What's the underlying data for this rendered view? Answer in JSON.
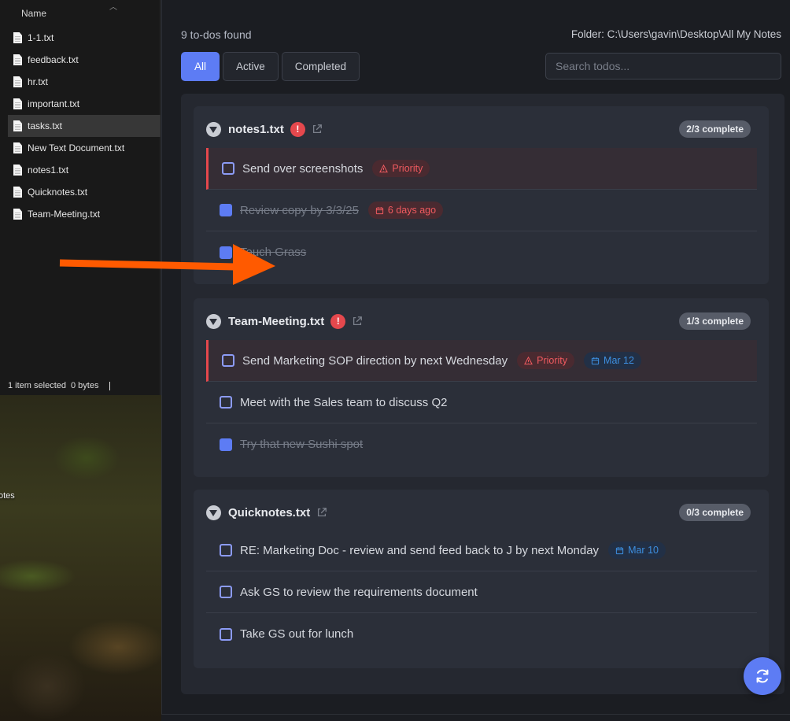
{
  "explorer": {
    "column_header": "Name",
    "files": [
      {
        "name": "1-1.txt",
        "selected": false
      },
      {
        "name": "feedback.txt",
        "selected": false
      },
      {
        "name": "hr.txt",
        "selected": false
      },
      {
        "name": "important.txt",
        "selected": false
      },
      {
        "name": "tasks.txt",
        "selected": true
      },
      {
        "name": "New Text Document.txt",
        "selected": false
      },
      {
        "name": "notes1.txt",
        "selected": false
      },
      {
        "name": "Quicknotes.txt",
        "selected": false
      },
      {
        "name": "Team-Meeting.txt",
        "selected": false
      }
    ],
    "status": {
      "selected": "1 item selected",
      "size": "0 bytes"
    }
  },
  "desktop": {
    "partial_label": "otes"
  },
  "app": {
    "count_text": "9 to-dos found",
    "folder_text": "Folder: C:\\Users\\gavin\\Desktop\\All My Notes",
    "filters": [
      {
        "label": "All",
        "active": true
      },
      {
        "label": "Active",
        "active": false
      },
      {
        "label": "Completed",
        "active": false
      }
    ],
    "search_placeholder": "Search todos...",
    "groups": [
      {
        "title": "notes1.txt",
        "has_priority_alert": true,
        "alert_glyph": "!",
        "progress": "2/3 complete",
        "todos": [
          {
            "text": "Send over screenshots",
            "done": false,
            "priority": true,
            "tags": [
              {
                "kind": "priority",
                "label": "Priority"
              }
            ]
          },
          {
            "text": "Review copy by 3/3/25",
            "done": true,
            "priority": false,
            "tags": [
              {
                "kind": "overdue",
                "label": "6 days ago"
              }
            ]
          },
          {
            "text": "Touch Grass",
            "done": true,
            "priority": false,
            "tags": []
          }
        ]
      },
      {
        "title": "Team-Meeting.txt",
        "has_priority_alert": true,
        "alert_glyph": "!",
        "progress": "1/3 complete",
        "todos": [
          {
            "text": "Send Marketing SOP direction by next Wednesday",
            "done": false,
            "priority": true,
            "tags": [
              {
                "kind": "priority",
                "label": "Priority"
              },
              {
                "kind": "date",
                "label": "Mar 12"
              }
            ]
          },
          {
            "text": "Meet with the Sales team to discuss Q2",
            "done": false,
            "priority": false,
            "tags": []
          },
          {
            "text": "Try that new Sushi spot",
            "done": true,
            "priority": false,
            "tags": []
          }
        ]
      },
      {
        "title": "Quicknotes.txt",
        "has_priority_alert": false,
        "progress": "0/3 complete",
        "todos": [
          {
            "text": "RE: Marketing Doc - review and send feed back to J by next Monday",
            "done": false,
            "priority": false,
            "tags": [
              {
                "kind": "date",
                "label": "Mar 10"
              }
            ]
          },
          {
            "text": "Ask GS to review the requirements document",
            "done": false,
            "priority": false,
            "tags": []
          },
          {
            "text": "Take GS out for lunch",
            "done": false,
            "priority": false,
            "tags": []
          }
        ]
      }
    ],
    "refresh_icon": "refresh-icon"
  },
  "colors": {
    "accent": "#5d7cf4",
    "priority_red": "#e5484d",
    "date_blue": "#3d8fe0",
    "annotation_arrow": "#ff5a00"
  }
}
